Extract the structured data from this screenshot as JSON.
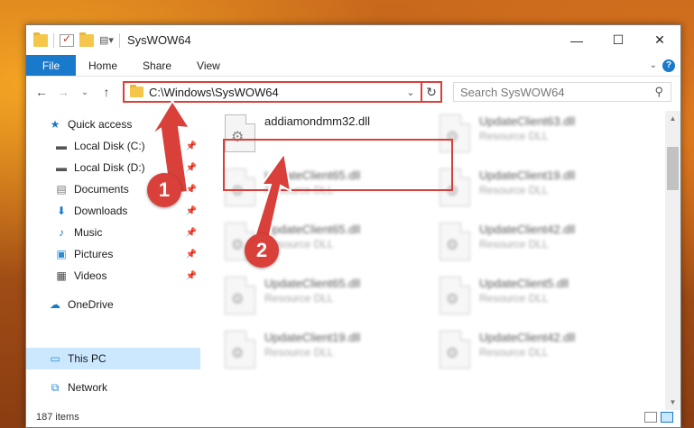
{
  "window": {
    "title": "SysWOW64",
    "controls": {
      "minimize": "—",
      "maximize": "☐",
      "close": "✕"
    }
  },
  "ribbon": {
    "tabs": [
      "File",
      "Home",
      "Share",
      "View"
    ]
  },
  "nav": {
    "address": "C:\\Windows\\SysWOW64",
    "search_placeholder": "Search SysWOW64"
  },
  "sidebar": {
    "items": [
      {
        "label": "Quick access",
        "icon": "star-icon",
        "pinned": false
      },
      {
        "label": "Local Disk (C:)",
        "icon": "drive-icon",
        "pinned": true
      },
      {
        "label": "Local Disk (D:)",
        "icon": "drive-icon",
        "pinned": true
      },
      {
        "label": "Documents",
        "icon": "document-icon",
        "pinned": true
      },
      {
        "label": "Downloads",
        "icon": "download-icon",
        "pinned": true
      },
      {
        "label": "Music",
        "icon": "music-icon",
        "pinned": true
      },
      {
        "label": "Pictures",
        "icon": "pictures-icon",
        "pinned": true
      },
      {
        "label": "Videos",
        "icon": "videos-icon",
        "pinned": true
      },
      {
        "label": "OneDrive",
        "icon": "cloud-icon",
        "pinned": false
      },
      {
        "label": "This PC",
        "icon": "computer-icon",
        "pinned": false,
        "selected": true
      },
      {
        "label": "Network",
        "icon": "network-icon",
        "pinned": false
      }
    ]
  },
  "files": {
    "highlighted": {
      "name": "addiamondmm32.dll",
      "type": ""
    },
    "items": [
      {
        "name": "UpdateClient63.dll",
        "type": "Resource DLL"
      },
      {
        "name": "UpdateClient65.dll",
        "type": "Resource DLL"
      },
      {
        "name": "UpdateClient19.dll",
        "type": "Resource DLL"
      },
      {
        "name": "UpdateClient65.dll",
        "type": "Resource DLL"
      },
      {
        "name": "UpdateClient42.dll",
        "type": "Resource DLL"
      },
      {
        "name": "UpdateClient65.dll",
        "type": "Resource DLL"
      },
      {
        "name": "UpdateClient5.dll",
        "type": "Resource DLL"
      },
      {
        "name": "UpdateClient19.dll",
        "type": "Resource DLL"
      },
      {
        "name": "UpdateClient42.dll",
        "type": "Resource DLL"
      }
    ]
  },
  "status": {
    "item_count": "187 items"
  },
  "annotations": {
    "step1": "1",
    "step2": "2"
  },
  "colors": {
    "accent": "#1979ca",
    "annotation_red": "#d9403a",
    "selection": "#cce8ff"
  }
}
